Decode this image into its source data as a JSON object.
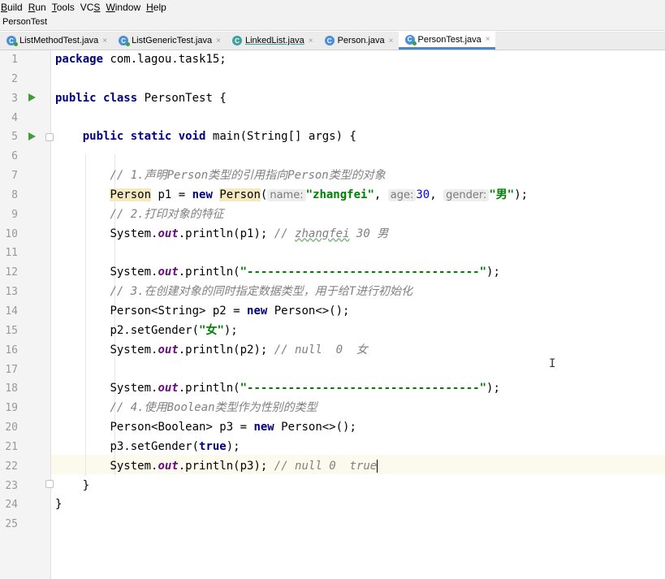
{
  "menu": [
    {
      "u": "B",
      "rest": "uild"
    },
    {
      "u": "R",
      "rest": "un"
    },
    {
      "u": "T",
      "rest": "ools"
    },
    {
      "u": "S",
      "pre": "VC",
      "rest": ""
    },
    {
      "u": "W",
      "rest": "indow"
    },
    {
      "u": "H",
      "rest": "elp"
    }
  ],
  "breadcrumb": "PersonTest",
  "tabs": [
    {
      "label": "ListMethodTest.java",
      "close": "×"
    },
    {
      "label": "ListGenericTest.java",
      "close": "×"
    },
    {
      "label": "LinkedList.java",
      "close": "×"
    },
    {
      "label": "Person.java",
      "close": "×"
    },
    {
      "label": "PersonTest.java",
      "close": "×"
    }
  ],
  "lines": [
    "1",
    "2",
    "3",
    "4",
    "5",
    "6",
    "7",
    "8",
    "9",
    "10",
    "11",
    "12",
    "13",
    "14",
    "15",
    "16",
    "17",
    "18",
    "19",
    "20",
    "21",
    "22",
    "23",
    "24",
    "25"
  ],
  "code": {
    "l1_kw": "package",
    "l1_rest": " com.lagou.task15;",
    "l3_kw1": "public",
    "l3_kw2": "class",
    "l3_rest": " PersonTest {",
    "l5_kw1": "public",
    "l5_kw2": "static",
    "l5_kw3": "void",
    "l5_rest": " main(String[] args) {",
    "l7_cm": "// 1.声明Person类型的引用指向Person类型的对象",
    "l8_t1": "Person",
    "l8_a": " p1 = ",
    "l8_new": "new",
    "l8_sp": " ",
    "l8_t2": "Person",
    "l8_p": "(",
    "l8_h1": "name:",
    "l8_s1": "\"zhangfei\"",
    "l8_c1": ", ",
    "l8_h2": "age:",
    "l8_n": "30",
    "l8_c2": ", ",
    "l8_h3": "gender:",
    "l8_s2": "\"男\"",
    "l8_end": ");",
    "l9_cm": "// 2.打印对象的特征",
    "l10_a": "System.",
    "l10_f": "out",
    "l10_b": ".println(p1); ",
    "l10_cm1": "// ",
    "l10_cm2": "zhangfei",
    "l10_cm3": " 30 男",
    "l12_a": "System.",
    "l12_f": "out",
    "l12_b": ".println(",
    "l12_s": "\"----------------------------------\"",
    "l12_end": ");",
    "l13_cm": "// 3.在创建对象的同时指定数据类型，用于给T进行初始化",
    "l14_a": "Person<String> p2 = ",
    "l14_new": "new",
    "l14_b": " Person<>();",
    "l15_a": "p2.setGender(",
    "l15_s": "\"女\"",
    "l15_end": ");",
    "l16_a": "System.",
    "l16_f": "out",
    "l16_b": ".println(p2); ",
    "l16_cm": "// null  0  女",
    "l18_a": "System.",
    "l18_f": "out",
    "l18_b": ".println(",
    "l18_s": "\"----------------------------------\"",
    "l18_end": ");",
    "l19_cm": "// 4.使用Boolean类型作为性别的类型",
    "l20_a": "Person<Boolean> p3 = ",
    "l20_new": "new",
    "l20_b": " Person<>();",
    "l21_a": "p3.setGender(",
    "l21_kw": "true",
    "l21_end": ");",
    "l22_a": "System.",
    "l22_f": "out",
    "l22_b": ".println(p3); ",
    "l22_cm": "// null 0  true",
    "l23": "    }",
    "l24": "}"
  },
  "ibeam": "I"
}
